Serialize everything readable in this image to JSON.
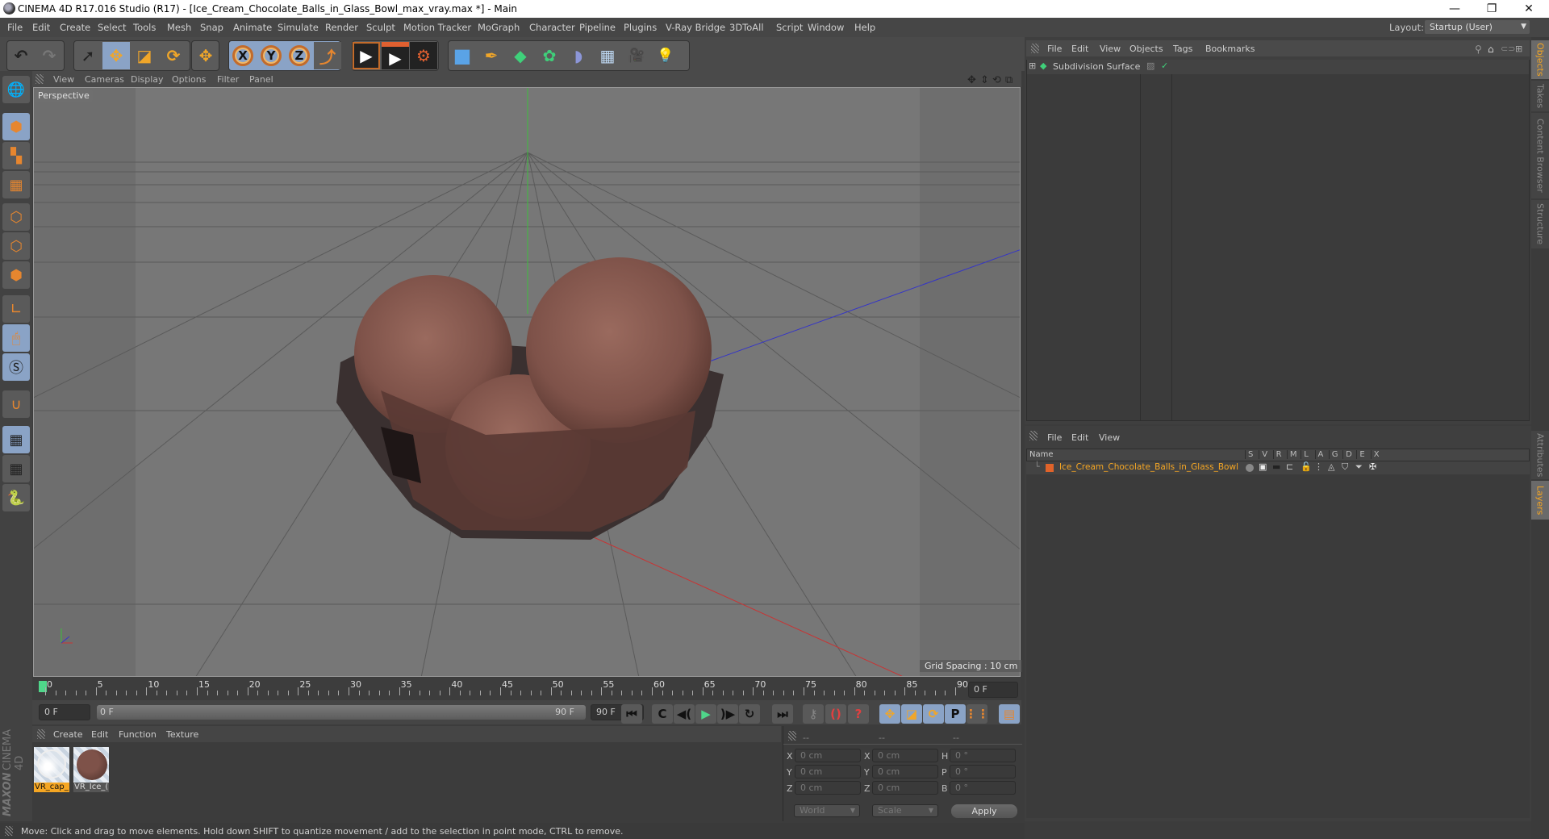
{
  "window": {
    "title": "CINEMA 4D R17.016 Studio (R17) - [Ice_Cream_Chocolate_Balls_in_Glass_Bowl_max_vray.max *] - Main",
    "minimize_icon": "—",
    "restore_icon": "❐",
    "close_icon": "✕"
  },
  "menubar": {
    "items": [
      "File",
      "Edit",
      "Create",
      "Select",
      "Tools",
      "Mesh",
      "Snap",
      "Animate",
      "Simulate",
      "Render",
      "Sculpt",
      "Motion Tracker",
      "MoGraph",
      "Character",
      "Pipeline",
      "Plugins",
      "V-Ray Bridge",
      "3DToAll",
      "Script",
      "Window",
      "Help"
    ],
    "layout_label": "Layout:",
    "layout_value": "Startup (User)"
  },
  "toolbar": {
    "undo": "↶",
    "redo": "↷",
    "select": "➚",
    "move": "✥",
    "scale": "◪",
    "rotate": "⟳",
    "move2": "✥",
    "axis_x": "X",
    "axis_y": "Y",
    "axis_z": "Z",
    "coord": "⤴",
    "render_view": "▶",
    "render_pic": "▶",
    "render_settings": "⚙",
    "cube": "■",
    "pen": "✒",
    "subdiv": "◆",
    "cloner": "✿",
    "deformer": "◗",
    "floor": "▦",
    "camera": "🎥",
    "light": "💡"
  },
  "left_tools": [
    "model",
    "texture",
    "workplane",
    "points",
    "edges",
    "polygons",
    "axis",
    "tweak",
    "snap-s",
    "magnet",
    "lock-grid",
    "grid-rotate",
    "python"
  ],
  "viewport": {
    "menu": [
      "View",
      "Cameras",
      "Display",
      "Options",
      "Filter",
      "Panel"
    ],
    "camera_label": "Perspective",
    "grid_spacing": "Grid Spacing : 10 cm",
    "nav_icons": [
      "✥",
      "⇕",
      "⟲",
      "⧉"
    ]
  },
  "timeline": {
    "labels": [
      "0",
      "5",
      "10",
      "15",
      "20",
      "25",
      "30",
      "35",
      "40",
      "45",
      "50",
      "55",
      "60",
      "65",
      "70",
      "75",
      "80",
      "85",
      "90"
    ],
    "current_frame": "0 F",
    "start_field": "0 F",
    "range_start": "0 F",
    "range_end": "90 F",
    "end_field": "90 F"
  },
  "playback": {
    "first": "⏮",
    "prev_key": "C",
    "prev": "◀(",
    "play": "▶",
    "next": ")▶",
    "next_key": "↻",
    "last": "⏭",
    "record_key": "⚷",
    "autokey": "()",
    "keyframe_help": "?",
    "pos": "✥",
    "scale": "◪",
    "rot": "⟳",
    "param": "P",
    "pla": "⋮⋮",
    "timeline_btn": "▤"
  },
  "material_manager": {
    "menu": [
      "Create",
      "Edit",
      "Function",
      "Texture"
    ],
    "materials": [
      {
        "name": "VR_cap_",
        "selected": true
      },
      {
        "name": "VR_Ice_(",
        "selected": false
      }
    ],
    "brand_top": "MAXON",
    "brand_bottom": "CINEMA 4D"
  },
  "coordinates": {
    "headers": [
      "--",
      "--",
      "--"
    ],
    "rows": [
      {
        "a": "X",
        "av": "0 cm",
        "b": "X",
        "bv": "0 cm",
        "c": "H",
        "cv": "0 °"
      },
      {
        "a": "Y",
        "av": "0 cm",
        "b": "Y",
        "bv": "0 cm",
        "c": "P",
        "cv": "0 °"
      },
      {
        "a": "Z",
        "av": "0 cm",
        "b": "Z",
        "bv": "0 cm",
        "c": "B",
        "cv": "0 °"
      }
    ],
    "mode": "World",
    "type": "Scale",
    "apply": "Apply"
  },
  "objects_panel": {
    "menu": [
      "File",
      "Edit",
      "View",
      "Objects",
      "Tags",
      "Bookmarks"
    ],
    "items": [
      {
        "name": "Subdivision Surface"
      }
    ]
  },
  "layers_panel": {
    "menu": [
      "File",
      "Edit",
      "View"
    ],
    "col_name": "Name",
    "columns": [
      "S",
      "V",
      "R",
      "M",
      "L",
      "A",
      "G",
      "D",
      "E",
      "X"
    ],
    "rows": [
      {
        "name": "Ice_Cream_Chocolate_Balls_in_Glass_Bowl",
        "color": "#e0632a"
      }
    ]
  },
  "side_tabs": {
    "top": [
      "Objects",
      "Takes",
      "Content Browser",
      "Structure"
    ],
    "bottom": [
      "Attributes",
      "Layers"
    ]
  },
  "status": "Move: Click and drag to move elements. Hold down SHIFT to quantize movement / add to the selection in point mode, CTRL to remove.",
  "colors": {
    "accent": "#f5a623",
    "selected_blue": "#8aa3c6",
    "layer_orange": "#e0632a"
  }
}
